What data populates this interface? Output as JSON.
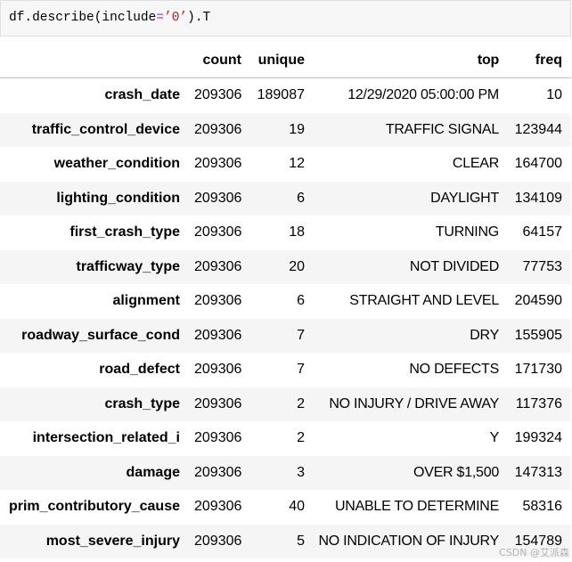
{
  "code_cell": {
    "tokens": [
      {
        "text": "df.describe(include",
        "color": "#000000"
      },
      {
        "text": "=",
        "color": "#AA22FF"
      },
      {
        "text": "’0’",
        "color": "#BA2121"
      },
      {
        "text": ").T",
        "color": "#000000"
      }
    ]
  },
  "table": {
    "columns": [
      "count",
      "unique",
      "top",
      "freq"
    ],
    "rows": [
      {
        "label": "crash_date",
        "count": 209306,
        "unique": 189087,
        "top": "12/29/2020 05:00:00 PM",
        "freq": 10
      },
      {
        "label": "traffic_control_device",
        "count": 209306,
        "unique": 19,
        "top": "TRAFFIC SIGNAL",
        "freq": 123944
      },
      {
        "label": "weather_condition",
        "count": 209306,
        "unique": 12,
        "top": "CLEAR",
        "freq": 164700
      },
      {
        "label": "lighting_condition",
        "count": 209306,
        "unique": 6,
        "top": "DAYLIGHT",
        "freq": 134109
      },
      {
        "label": "first_crash_type",
        "count": 209306,
        "unique": 18,
        "top": "TURNING",
        "freq": 64157
      },
      {
        "label": "trafficway_type",
        "count": 209306,
        "unique": 20,
        "top": "NOT DIVIDED",
        "freq": 77753
      },
      {
        "label": "alignment",
        "count": 209306,
        "unique": 6,
        "top": "STRAIGHT AND LEVEL",
        "freq": 204590
      },
      {
        "label": "roadway_surface_cond",
        "count": 209306,
        "unique": 7,
        "top": "DRY",
        "freq": 155905
      },
      {
        "label": "road_defect",
        "count": 209306,
        "unique": 7,
        "top": "NO DEFECTS",
        "freq": 171730
      },
      {
        "label": "crash_type",
        "count": 209306,
        "unique": 2,
        "top": "NO INJURY / DRIVE AWAY",
        "freq": 117376
      },
      {
        "label": "intersection_related_i",
        "count": 209306,
        "unique": 2,
        "top": "Y",
        "freq": 199324
      },
      {
        "label": "damage",
        "count": 209306,
        "unique": 3,
        "top": "OVER $1,500",
        "freq": 147313
      },
      {
        "label": "prim_contributory_cause",
        "count": 209306,
        "unique": 40,
        "top": "UNABLE TO DETERMINE",
        "freq": 58316
      },
      {
        "label": "most_severe_injury",
        "count": 209306,
        "unique": 5,
        "top": "NO INDICATION OF INJURY",
        "freq": 154789
      }
    ]
  },
  "colors": {
    "code_background": "#f7f7f7",
    "code_border": "#e0e0e0",
    "header_rule": "#bdbdbd",
    "row_alt_background": "#f5f5f5",
    "text": "#000000"
  },
  "watermark": {
    "text": "CSDN @艾派森"
  }
}
